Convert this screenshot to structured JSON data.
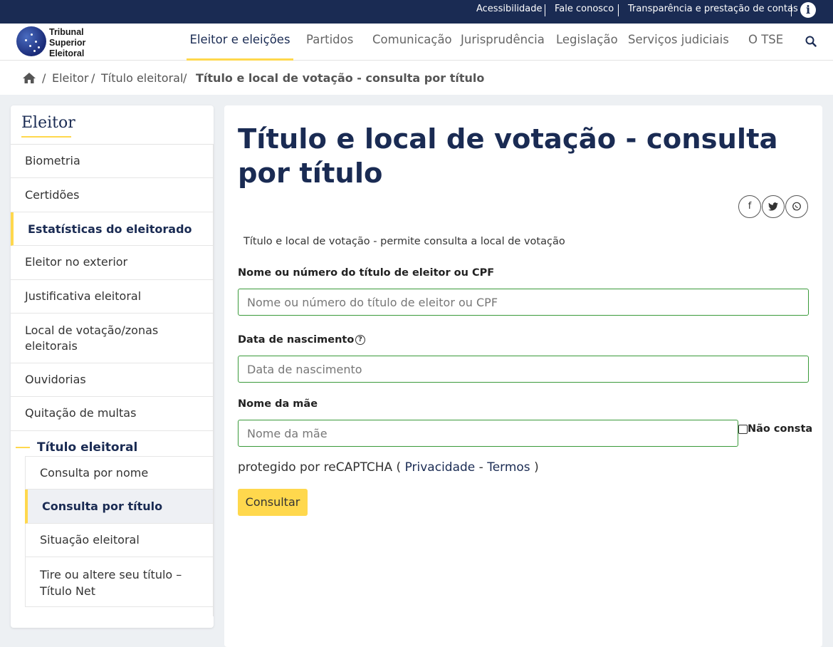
{
  "topbar": {
    "links": [
      "Acessibilidade",
      "Fale conosco",
      "Transparência e prestação de contas"
    ],
    "info_icon": "info-icon"
  },
  "logo": {
    "line1": "Tribunal",
    "line2": "Superior",
    "line3": "Eleitoral"
  },
  "nav": {
    "items": [
      "Eleitor e eleições",
      "Partidos",
      "Comunicação",
      "Jurisprudência",
      "Legislação",
      "Serviços judiciais",
      "O TSE"
    ],
    "active": "Eleitor e eleições",
    "search_icon": "search-icon"
  },
  "breadcrumb": {
    "home_icon": "home-icon",
    "items": [
      "Eleitor",
      "Título eleitoral",
      "Título e local de votação - consulta por título"
    ],
    "separator": "/"
  },
  "sidebar": {
    "title": "Eleitor",
    "items": [
      "Biometria",
      "Certidões",
      "Estatísticas do eleitorado",
      "Eleitor no exterior",
      "Justificativa eleitoral",
      "Local de votação/zonas eleitorais",
      "Ouvidorias",
      "Quitação de multas"
    ],
    "section": "Título eleitoral",
    "subitems": [
      "Consulta por nome",
      "Consulta por título",
      "Situação eleitoral",
      "Tire ou altere seu título – Título Net"
    ],
    "active_subitem": "Consulta por título"
  },
  "main": {
    "title": "Título e local de votação - consulta por título",
    "share": {
      "facebook": "f",
      "twitter": "twitter-icon",
      "whatsapp": "whatsapp-icon"
    },
    "description": "Título e local de votação - permite consulta a local de votação",
    "fields": {
      "id_label": "Nome ou número do título de eleitor ou CPF",
      "id_placeholder": "Nome ou número do título de eleitor ou CPF",
      "birth_label": "Data de nascimento",
      "birth_help": "?",
      "birth_placeholder": "Data de nascimento",
      "mother_label": "Nome da mãe",
      "mother_placeholder": "Nome da mãe",
      "no_mother_label": "Não consta"
    },
    "recaptcha": {
      "text": "protegido por reCAPTCHA (",
      "privacy": "Privacidade",
      "dash": "-",
      "terms": "Termos",
      "close": ")"
    },
    "submit_label": "Consultar"
  },
  "colors": {
    "navy": "#1a2b53",
    "accent": "#ffd84d",
    "input_border": "#3a9a3a"
  }
}
